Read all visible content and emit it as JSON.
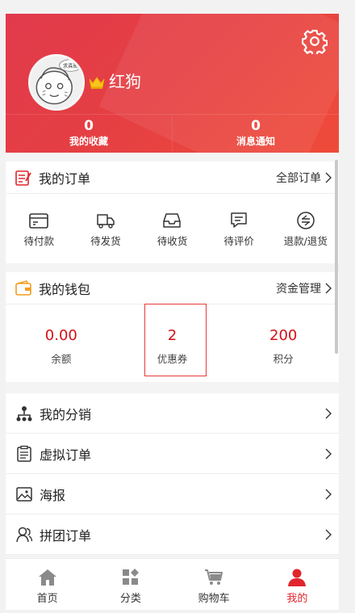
{
  "header": {
    "username": "红狗",
    "avatar_badge": "求真图",
    "stats": [
      {
        "value": "0",
        "label": "我的收藏"
      },
      {
        "value": "0",
        "label": "消息通知"
      }
    ]
  },
  "orders": {
    "title": "我的订单",
    "more": "全部订单",
    "items": [
      {
        "label": "待付款",
        "icon": "wallet-card-icon"
      },
      {
        "label": "待发货",
        "icon": "truck-icon"
      },
      {
        "label": "待收货",
        "icon": "inbox-icon"
      },
      {
        "label": "待评价",
        "icon": "comment-icon"
      },
      {
        "label": "退款/退货",
        "icon": "refund-icon"
      }
    ]
  },
  "wallet": {
    "title": "我的钱包",
    "more": "资金管理",
    "items": [
      {
        "value": "0.00",
        "label": "余额"
      },
      {
        "value": "2",
        "label": "优惠券"
      },
      {
        "value": "200",
        "label": "积分"
      }
    ]
  },
  "menu": [
    {
      "label": "我的分销",
      "icon": "distribution-icon"
    },
    {
      "label": "虚拟订单",
      "icon": "clipboard-icon"
    },
    {
      "label": "海报",
      "icon": "image-icon"
    },
    {
      "label": "拼团订单",
      "icon": "group-icon"
    }
  ],
  "tabbar": [
    {
      "label": "首页",
      "icon": "home-icon"
    },
    {
      "label": "分类",
      "icon": "category-icon"
    },
    {
      "label": "购物车",
      "icon": "cart-icon"
    },
    {
      "label": "我的",
      "icon": "user-icon",
      "active": true
    }
  ],
  "colors": {
    "accent": "#e0252c",
    "header_start": "#e23a4c",
    "header_end": "#ef4b3a",
    "inactive_tab": "#8a8a8a"
  }
}
